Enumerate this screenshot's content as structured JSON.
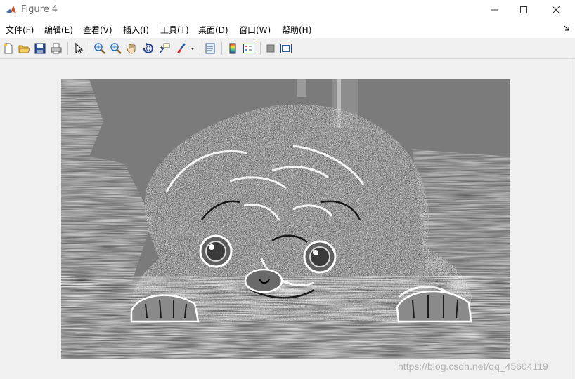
{
  "window": {
    "title": "Figure 4",
    "icon": "matlab-logo-icon",
    "controls": [
      "minimize-icon",
      "maximize-icon",
      "close-icon"
    ]
  },
  "menubar": {
    "items": [
      {
        "label": "文件(F)"
      },
      {
        "label": "编辑(E)"
      },
      {
        "label": "查看(V)"
      },
      {
        "label": "插入(I)"
      },
      {
        "label": "工具(T)"
      },
      {
        "label": "桌面(D)"
      },
      {
        "label": "窗口(W)"
      },
      {
        "label": "帮助(H)"
      }
    ],
    "overflow_icon": "menu-arrow-icon"
  },
  "toolbar": {
    "buttons": [
      "new-figure-icon",
      "open-file-icon",
      "save-icon",
      "print-icon",
      "edit-plot-pointer-icon",
      "zoom-in-icon",
      "zoom-out-icon",
      "pan-hand-icon",
      "rotate-3d-icon",
      "data-cursor-icon",
      "brush-icon",
      "link-plot-icon",
      "insert-colorbar-icon",
      "insert-legend-icon",
      "hide-plot-tools-icon",
      "show-plot-tools-icon"
    ]
  },
  "figure": {
    "content": "edge-filtered grayscale image of a pug lying down",
    "background_color": "#7a7a7a"
  },
  "watermark": {
    "text": "https://blog.csdn.net/qq_45604119"
  }
}
